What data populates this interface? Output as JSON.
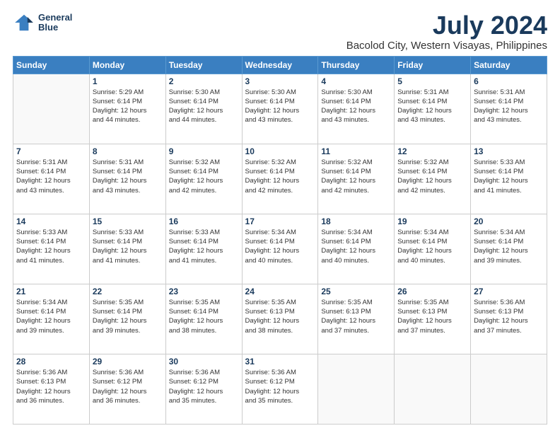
{
  "logo": {
    "line1": "General",
    "line2": "Blue"
  },
  "title": "July 2024",
  "subtitle": "Bacolod City, Western Visayas, Philippines",
  "header_row": [
    "Sunday",
    "Monday",
    "Tuesday",
    "Wednesday",
    "Thursday",
    "Friday",
    "Saturday"
  ],
  "weeks": [
    [
      {
        "day": "",
        "info": ""
      },
      {
        "day": "1",
        "info": "Sunrise: 5:29 AM\nSunset: 6:14 PM\nDaylight: 12 hours\nand 44 minutes."
      },
      {
        "day": "2",
        "info": "Sunrise: 5:30 AM\nSunset: 6:14 PM\nDaylight: 12 hours\nand 44 minutes."
      },
      {
        "day": "3",
        "info": "Sunrise: 5:30 AM\nSunset: 6:14 PM\nDaylight: 12 hours\nand 43 minutes."
      },
      {
        "day": "4",
        "info": "Sunrise: 5:30 AM\nSunset: 6:14 PM\nDaylight: 12 hours\nand 43 minutes."
      },
      {
        "day": "5",
        "info": "Sunrise: 5:31 AM\nSunset: 6:14 PM\nDaylight: 12 hours\nand 43 minutes."
      },
      {
        "day": "6",
        "info": "Sunrise: 5:31 AM\nSunset: 6:14 PM\nDaylight: 12 hours\nand 43 minutes."
      }
    ],
    [
      {
        "day": "7",
        "info": "Sunrise: 5:31 AM\nSunset: 6:14 PM\nDaylight: 12 hours\nand 43 minutes."
      },
      {
        "day": "8",
        "info": "Sunrise: 5:31 AM\nSunset: 6:14 PM\nDaylight: 12 hours\nand 43 minutes."
      },
      {
        "day": "9",
        "info": "Sunrise: 5:32 AM\nSunset: 6:14 PM\nDaylight: 12 hours\nand 42 minutes."
      },
      {
        "day": "10",
        "info": "Sunrise: 5:32 AM\nSunset: 6:14 PM\nDaylight: 12 hours\nand 42 minutes."
      },
      {
        "day": "11",
        "info": "Sunrise: 5:32 AM\nSunset: 6:14 PM\nDaylight: 12 hours\nand 42 minutes."
      },
      {
        "day": "12",
        "info": "Sunrise: 5:32 AM\nSunset: 6:14 PM\nDaylight: 12 hours\nand 42 minutes."
      },
      {
        "day": "13",
        "info": "Sunrise: 5:33 AM\nSunset: 6:14 PM\nDaylight: 12 hours\nand 41 minutes."
      }
    ],
    [
      {
        "day": "14",
        "info": "Sunrise: 5:33 AM\nSunset: 6:14 PM\nDaylight: 12 hours\nand 41 minutes."
      },
      {
        "day": "15",
        "info": "Sunrise: 5:33 AM\nSunset: 6:14 PM\nDaylight: 12 hours\nand 41 minutes."
      },
      {
        "day": "16",
        "info": "Sunrise: 5:33 AM\nSunset: 6:14 PM\nDaylight: 12 hours\nand 41 minutes."
      },
      {
        "day": "17",
        "info": "Sunrise: 5:34 AM\nSunset: 6:14 PM\nDaylight: 12 hours\nand 40 minutes."
      },
      {
        "day": "18",
        "info": "Sunrise: 5:34 AM\nSunset: 6:14 PM\nDaylight: 12 hours\nand 40 minutes."
      },
      {
        "day": "19",
        "info": "Sunrise: 5:34 AM\nSunset: 6:14 PM\nDaylight: 12 hours\nand 40 minutes."
      },
      {
        "day": "20",
        "info": "Sunrise: 5:34 AM\nSunset: 6:14 PM\nDaylight: 12 hours\nand 39 minutes."
      }
    ],
    [
      {
        "day": "21",
        "info": "Sunrise: 5:34 AM\nSunset: 6:14 PM\nDaylight: 12 hours\nand 39 minutes."
      },
      {
        "day": "22",
        "info": "Sunrise: 5:35 AM\nSunset: 6:14 PM\nDaylight: 12 hours\nand 39 minutes."
      },
      {
        "day": "23",
        "info": "Sunrise: 5:35 AM\nSunset: 6:14 PM\nDaylight: 12 hours\nand 38 minutes."
      },
      {
        "day": "24",
        "info": "Sunrise: 5:35 AM\nSunset: 6:13 PM\nDaylight: 12 hours\nand 38 minutes."
      },
      {
        "day": "25",
        "info": "Sunrise: 5:35 AM\nSunset: 6:13 PM\nDaylight: 12 hours\nand 37 minutes."
      },
      {
        "day": "26",
        "info": "Sunrise: 5:35 AM\nSunset: 6:13 PM\nDaylight: 12 hours\nand 37 minutes."
      },
      {
        "day": "27",
        "info": "Sunrise: 5:36 AM\nSunset: 6:13 PM\nDaylight: 12 hours\nand 37 minutes."
      }
    ],
    [
      {
        "day": "28",
        "info": "Sunrise: 5:36 AM\nSunset: 6:13 PM\nDaylight: 12 hours\nand 36 minutes."
      },
      {
        "day": "29",
        "info": "Sunrise: 5:36 AM\nSunset: 6:12 PM\nDaylight: 12 hours\nand 36 minutes."
      },
      {
        "day": "30",
        "info": "Sunrise: 5:36 AM\nSunset: 6:12 PM\nDaylight: 12 hours\nand 35 minutes."
      },
      {
        "day": "31",
        "info": "Sunrise: 5:36 AM\nSunset: 6:12 PM\nDaylight: 12 hours\nand 35 minutes."
      },
      {
        "day": "",
        "info": ""
      },
      {
        "day": "",
        "info": ""
      },
      {
        "day": "",
        "info": ""
      }
    ]
  ]
}
